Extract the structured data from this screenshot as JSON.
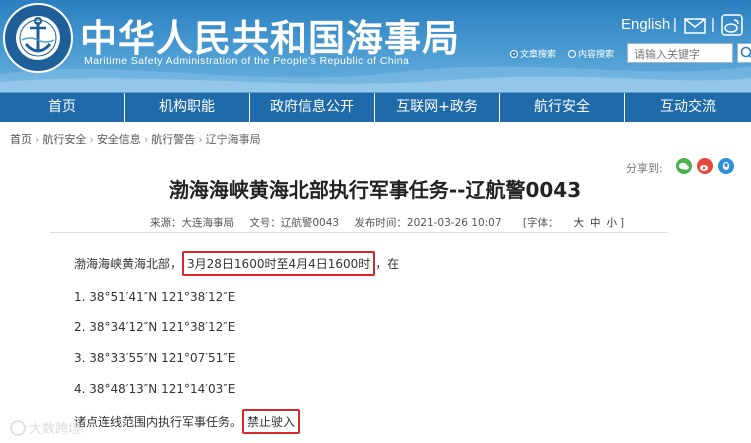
{
  "header": {
    "title": "中华人民共和国海事局",
    "subtitle": "Maritime Safety Administration of the People's Republic of China",
    "logo_text_top": "中 国 海 事",
    "logo_text_bottom": "CHINA MSA",
    "english_link": "English",
    "separator": "|",
    "search": {
      "options": [
        "文章搜索",
        "内容搜索"
      ],
      "selected": "文章搜索",
      "placeholder": "请输入关键字"
    },
    "colors": {
      "header_blue": "#2a7fbf",
      "nav_blue": "#1f6aa8"
    }
  },
  "nav": {
    "items": [
      "首页",
      "机构职能",
      "政府信息公开",
      "互联网+政务",
      "航行安全",
      "互动交流"
    ]
  },
  "breadcrumb": {
    "items": [
      "首页",
      "航行安全",
      "安全信息",
      "航行警告",
      "辽宁海事局"
    ],
    "arrow": "›"
  },
  "share": {
    "label": "分享到:",
    "icons": [
      "wechat-icon",
      "weibo-icon",
      "qq-icon"
    ]
  },
  "article": {
    "title": "渤海海峡黄海北部执行军事任务--辽航警0043",
    "meta": {
      "source": "来源：大连海事局",
      "doc_no": "文号：辽航警0043",
      "publish_time": "发布时间：2021-03-26 10:07",
      "font_label": "[字体：",
      "font_sizes": [
        "大",
        "中",
        "小"
      ],
      "font_end": "]"
    },
    "intro_prefix": "渤海海峡黄海北部，",
    "intro_highlight": "3月28日1600时至4月4日1600时",
    "intro_suffix": "，在",
    "points": [
      "1. 38°51′41″N    121°38′12″E",
      "2. 38°34′12″N    121°38′12″E",
      "3. 38°33′55″N    121°07′51″E",
      "4. 38°48′13″N    121°14′03″E"
    ],
    "closing_prefix": "诸点连线范围内执行军事任务。",
    "closing_highlight": "禁止驶入",
    "highlight_color": "#d9262b"
  },
  "watermark": {
    "text": "大数跨境"
  }
}
